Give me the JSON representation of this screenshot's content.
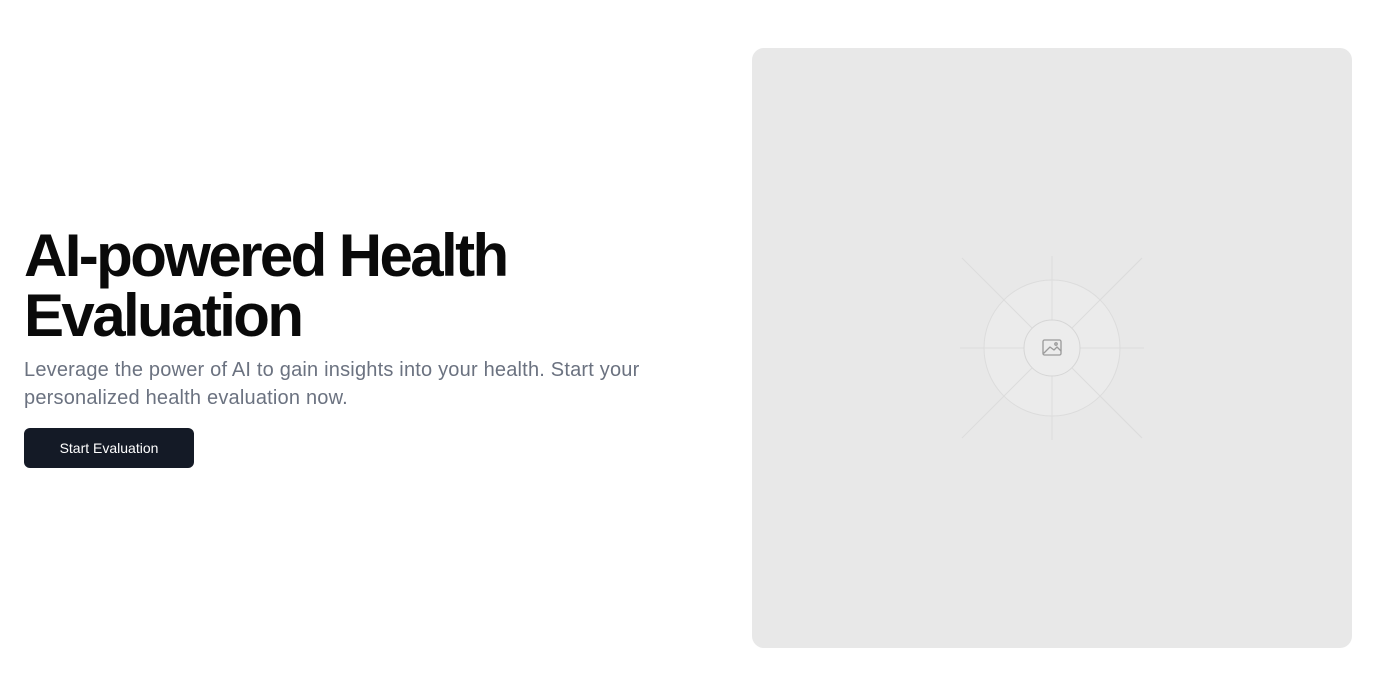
{
  "hero": {
    "title_line1": "AI-powered Health",
    "title_line2": "Evaluation",
    "subtitle": "Leverage the power of AI to gain insights into your health. Start your personalized health evaluation now.",
    "cta_label": "Start Evaluation"
  },
  "media": {
    "icon": "image-icon"
  },
  "colors": {
    "button_bg": "#141a26",
    "subtitle_text": "#6b7280",
    "placeholder_bg": "#e8e8e8"
  }
}
